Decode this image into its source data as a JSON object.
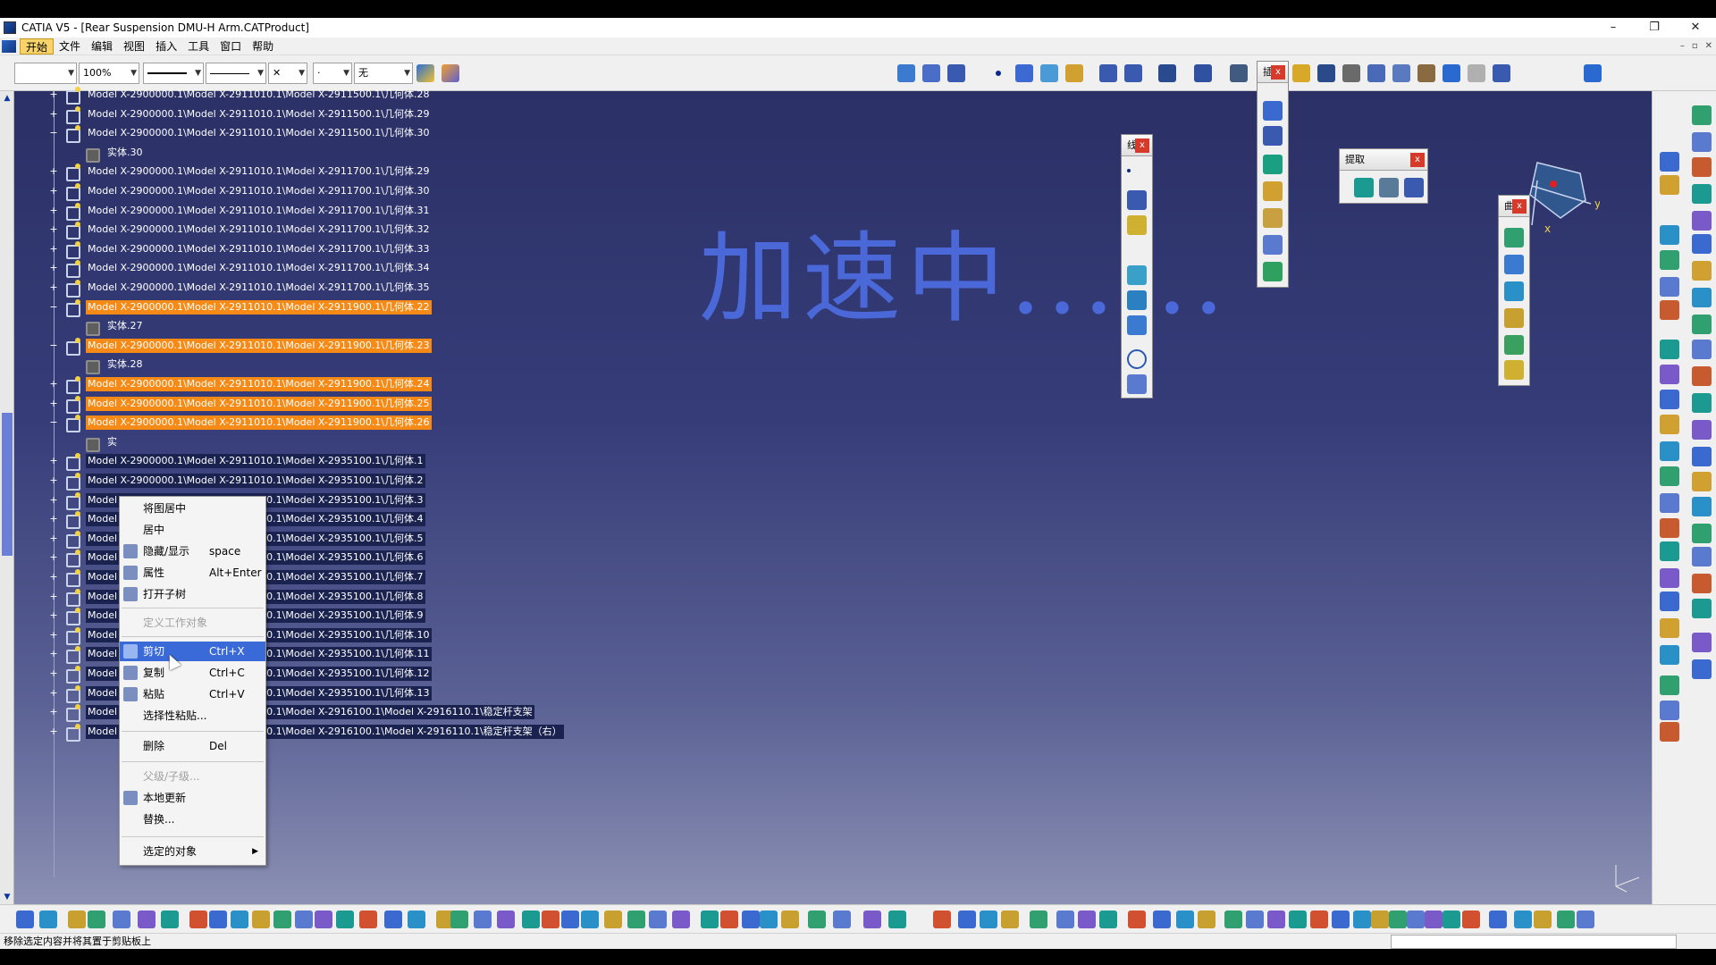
{
  "window": {
    "title": "CATIA V5 - [Rear Suspension DMU-H Arm.CATProduct]",
    "controls": [
      "–",
      "❐",
      "✕"
    ]
  },
  "menubar": {
    "items": [
      "开始",
      "文件",
      "编辑",
      "视图",
      "插入",
      "工具",
      "窗口",
      "帮助"
    ],
    "active_index": 0,
    "mdi_controls": [
      "–",
      "▫",
      "✕"
    ]
  },
  "toolbar_top": {
    "zoom_value": "100%",
    "layer_value": "无",
    "combo_x": "✕",
    "combo_point": "·"
  },
  "tree": {
    "rows": [
      {
        "label": "Model X-2900000.1\\Model X-2911010.1\\Model X-2911500.1\\几何体.28",
        "kind": "node",
        "state": "normal",
        "exp": "+"
      },
      {
        "label": "Model X-2900000.1\\Model X-2911010.1\\Model X-2911500.1\\几何体.29",
        "kind": "node",
        "state": "normal",
        "exp": "+"
      },
      {
        "label": "Model X-2900000.1\\Model X-2911010.1\\Model X-2911500.1\\几何体.30",
        "kind": "node",
        "state": "normal",
        "exp": "−"
      },
      {
        "label": "实体.30",
        "kind": "body",
        "state": "normal",
        "exp": ""
      },
      {
        "label": "Model X-2900000.1\\Model X-2911010.1\\Model X-2911700.1\\几何体.29",
        "kind": "node",
        "state": "normal",
        "exp": "+"
      },
      {
        "label": "Model X-2900000.1\\Model X-2911010.1\\Model X-2911700.1\\几何体.30",
        "kind": "node",
        "state": "normal",
        "exp": "+"
      },
      {
        "label": "Model X-2900000.1\\Model X-2911010.1\\Model X-2911700.1\\几何体.31",
        "kind": "node",
        "state": "normal",
        "exp": "+"
      },
      {
        "label": "Model X-2900000.1\\Model X-2911010.1\\Model X-2911700.1\\几何体.32",
        "kind": "node",
        "state": "normal",
        "exp": "+"
      },
      {
        "label": "Model X-2900000.1\\Model X-2911010.1\\Model X-2911700.1\\几何体.33",
        "kind": "node",
        "state": "normal",
        "exp": "+"
      },
      {
        "label": "Model X-2900000.1\\Model X-2911010.1\\Model X-2911700.1\\几何体.34",
        "kind": "node",
        "state": "normal",
        "exp": "+"
      },
      {
        "label": "Model X-2900000.1\\Model X-2911010.1\\Model X-2911700.1\\几何体.35",
        "kind": "node",
        "state": "normal",
        "exp": "+"
      },
      {
        "label": "Model X-2900000.1\\Model X-2911010.1\\Model X-2911900.1\\几何体.22",
        "kind": "node",
        "state": "selected",
        "exp": "−"
      },
      {
        "label": "实体.27",
        "kind": "body",
        "state": "normal",
        "exp": ""
      },
      {
        "label": "Model X-2900000.1\\Model X-2911010.1\\Model X-2911900.1\\几何体.23",
        "kind": "node",
        "state": "selected",
        "exp": "−"
      },
      {
        "label": "实体.28",
        "kind": "body",
        "state": "normal",
        "exp": ""
      },
      {
        "label": "Model X-2900000.1\\Model X-2911010.1\\Model X-2911900.1\\几何体.24",
        "kind": "node",
        "state": "selected",
        "exp": "+"
      },
      {
        "label": "Model X-2900000.1\\Model X-2911010.1\\Model X-2911900.1\\几何体.25",
        "kind": "node",
        "state": "selected",
        "exp": "+"
      },
      {
        "label": "Model X-2900000.1\\Model X-2911010.1\\Model X-2911900.1\\几何体.26",
        "kind": "node",
        "state": "selected",
        "exp": "−"
      },
      {
        "label": "实",
        "kind": "body",
        "state": "normal",
        "exp": ""
      },
      {
        "label": "Model X-2900000.1\\Model X-2911010.1\\Model X-2935100.1\\几何体.1",
        "kind": "node",
        "state": "darksel",
        "exp": "+"
      },
      {
        "label": "Model X-2900000.1\\Model X-2911010.1\\Model X-2935100.1\\几何体.2",
        "kind": "node",
        "state": "darksel",
        "exp": "+"
      },
      {
        "label": "Model X-2900000.1\\Model X-2911010.1\\Model X-2935100.1\\几何体.3",
        "kind": "node",
        "state": "darksel",
        "exp": "+"
      },
      {
        "label": "Model X-2900000.1\\Model X-2911010.1\\Model X-2935100.1\\几何体.4",
        "kind": "node",
        "state": "darksel",
        "exp": "+"
      },
      {
        "label": "Model X-2900000.1\\Model X-2911010.1\\Model X-2935100.1\\几何体.5",
        "kind": "node",
        "state": "darksel",
        "exp": "+"
      },
      {
        "label": "Model X-2900000.1\\Model X-2911010.1\\Model X-2935100.1\\几何体.6",
        "kind": "node",
        "state": "darksel",
        "exp": "+"
      },
      {
        "label": "Model X-2900000.1\\Model X-2911010.1\\Model X-2935100.1\\几何体.7",
        "kind": "node",
        "state": "darksel",
        "exp": "+"
      },
      {
        "label": "Model X-2900000.1\\Model X-2911010.1\\Model X-2935100.1\\几何体.8",
        "kind": "node",
        "state": "darksel",
        "exp": "+"
      },
      {
        "label": "Model X-2900000.1\\Model X-2911010.1\\Model X-2935100.1\\几何体.9",
        "kind": "node",
        "state": "darksel",
        "exp": "+"
      },
      {
        "label": "Model X-2900000.1\\Model X-2911010.1\\Model X-2935100.1\\几何体.10",
        "kind": "node",
        "state": "darksel",
        "exp": "+"
      },
      {
        "label": "Model X-2900000.1\\Model X-2911010.1\\Model X-2935100.1\\几何体.11",
        "kind": "node",
        "state": "darksel",
        "exp": "+"
      },
      {
        "label": "Model X-2900000.1\\Model X-2911010.1\\Model X-2935100.1\\几何体.12",
        "kind": "node",
        "state": "darksel",
        "exp": "+"
      },
      {
        "label": "Model X-2900000.1\\Model X-2911010.1\\Model X-2935100.1\\几何体.13",
        "kind": "node",
        "state": "darksel",
        "exp": "+"
      },
      {
        "label": "Model X-2900000.1\\Model X-2911010.1\\Model X-2916100.1\\Model X-2916110.1\\稳定杆支架",
        "kind": "node",
        "state": "darksel",
        "exp": "+"
      },
      {
        "label": "Model X-2900000.1\\Model X-2911010.1\\Model X-2916100.1\\Model X-2916110.1\\稳定杆支架（右）",
        "kind": "node",
        "state": "darksel",
        "exp": "+"
      }
    ]
  },
  "viewport": {
    "watermark": "加速中......"
  },
  "context_menu": {
    "items": [
      {
        "label": "将图居中",
        "shortcut": "",
        "icon": "",
        "state": "normal"
      },
      {
        "label": "居中",
        "shortcut": "",
        "icon": "",
        "state": "normal"
      },
      {
        "label": "隐藏/显示",
        "shortcut": "space",
        "icon": "hide-show-icon",
        "state": "normal"
      },
      {
        "label": "属性",
        "shortcut": "Alt+Enter",
        "icon": "properties-icon",
        "state": "normal"
      },
      {
        "label": "打开子树",
        "shortcut": "",
        "icon": "tree-icon",
        "state": "normal"
      },
      {
        "label": "定义工作对象",
        "shortcut": "",
        "icon": "",
        "state": "disabled"
      },
      {
        "label": "剪切",
        "shortcut": "Ctrl+X",
        "icon": "scissors-icon",
        "state": "hover"
      },
      {
        "label": "复制",
        "shortcut": "Ctrl+C",
        "icon": "copy-icon",
        "state": "normal"
      },
      {
        "label": "粘贴",
        "shortcut": "Ctrl+V",
        "icon": "paste-icon",
        "state": "normal"
      },
      {
        "label": "选择性粘贴...",
        "shortcut": "",
        "icon": "",
        "state": "normal"
      },
      {
        "label": "删除",
        "shortcut": "Del",
        "icon": "",
        "state": "normal"
      },
      {
        "label": "父级/子级...",
        "shortcut": "",
        "icon": "",
        "state": "disabled"
      },
      {
        "label": "本地更新",
        "shortcut": "",
        "icon": "update-icon",
        "state": "normal"
      },
      {
        "label": "替换...",
        "shortcut": "",
        "icon": "",
        "state": "normal"
      },
      {
        "label": "选定的对象",
        "shortcut": "",
        "icon": "",
        "state": "submenu"
      }
    ]
  },
  "floating_toolbars": {
    "tb1_title": "线",
    "tb2_title": "插",
    "tb3_title": "提取",
    "tb4_title": "曲"
  },
  "compass": {
    "axis_x": "x",
    "axis_y": "y"
  },
  "statusbar": {
    "message": "移除选定内容并将其置于剪贴板上"
  },
  "colors": {
    "selection_orange": "#f58a16",
    "menu_hover": "#3a6ad8",
    "viewport_top": "#2b3166",
    "watermark": "#4a68d8"
  }
}
